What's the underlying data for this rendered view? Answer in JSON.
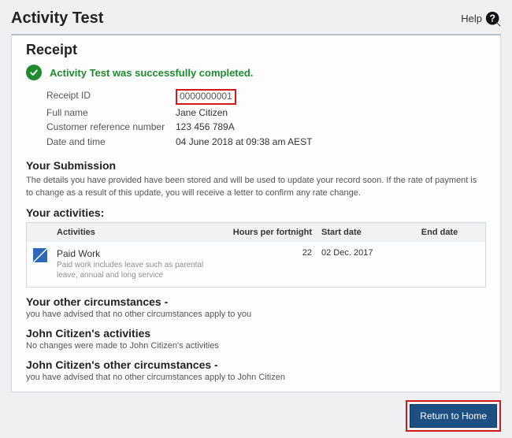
{
  "header": {
    "title": "Activity Test",
    "help_label": "Help"
  },
  "receipt": {
    "heading": "Receipt",
    "success_message": "Activity Test was successfully completed.",
    "fields": {
      "receipt_id_label": "Receipt ID",
      "receipt_id_value": "0000000001",
      "full_name_label": "Full name",
      "full_name_value": "Jane Citizen",
      "crn_label": "Customer reference number",
      "crn_value": "123 456 789A",
      "datetime_label": "Date and time",
      "datetime_value": "04 June 2018 at 09:38 am AEST"
    }
  },
  "submission": {
    "heading": "Your Submission",
    "text": "The details you have provided have been stored and will be used to update your record soon. If the rate of payment is to change as a result of this update, you will receive a letter to confirm any rate change."
  },
  "activities": {
    "heading": "Your activities:",
    "columns": {
      "activities": "Activities",
      "hpf": "Hours per fortnight",
      "start": "Start date",
      "end": "End date"
    },
    "rows": [
      {
        "name": "Paid Work",
        "description": "Paid work includes leave such as parental leave, annual and long service",
        "hours": "22",
        "start": "02 Dec. 2017",
        "end": ""
      }
    ]
  },
  "other_circ": {
    "heading": "Your other circumstances -",
    "text": "you have advised that no other circumstances apply to you"
  },
  "partner_activities": {
    "heading": "John Citizen's activities",
    "text": "No changes were made to John Citizen's activities"
  },
  "partner_circ": {
    "heading": "John Citizen's other circumstances -",
    "text": "you have advised that no other circumstances apply to John Citizen"
  },
  "footer": {
    "return_label": "Return to Home"
  }
}
